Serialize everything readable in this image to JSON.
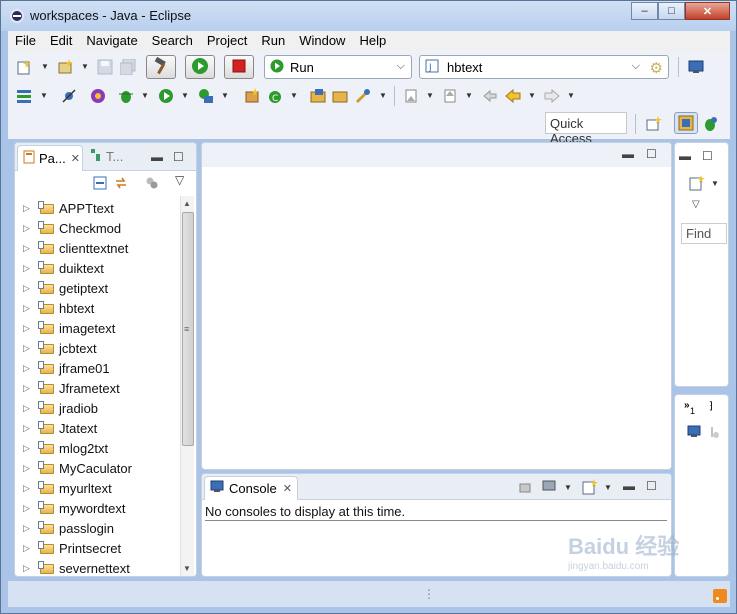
{
  "window": {
    "title": "workspaces - Java - Eclipse",
    "min": "–",
    "max": "□",
    "close": "✕"
  },
  "menu": [
    "File",
    "Edit",
    "Navigate",
    "Search",
    "Project",
    "Run",
    "Window",
    "Help"
  ],
  "toolbar": {
    "run_config": "Run",
    "launch_target": "hbtext",
    "quick_access": "Quick Access"
  },
  "package_explorer": {
    "tab_label": "Pa...",
    "other_tab_label": "T...",
    "projects": [
      "APPTtext",
      "Checkmod",
      "clienttextnet",
      "duiktext",
      "getiptext",
      "hbtext",
      "imagetext",
      "jcbtext",
      "jframe01",
      "Jframetext",
      "jradiob",
      "Jtatext",
      "mlog2txt",
      "MyCaculator",
      "myurltext",
      "mywordtext",
      "passlogin",
      "Printsecret",
      "severnettext"
    ]
  },
  "outline": {
    "find_placeholder": "Find"
  },
  "minimized": {
    "badge": "1"
  },
  "console": {
    "tab_label": "Console",
    "message": "No consoles to display at this time."
  },
  "watermark": {
    "brand": "Baidu 经验",
    "url": "jingyan.baidu.com"
  },
  "colors": {
    "accent": "#2c7a2c",
    "stop": "#d32020",
    "folder": "#e6b44b"
  }
}
